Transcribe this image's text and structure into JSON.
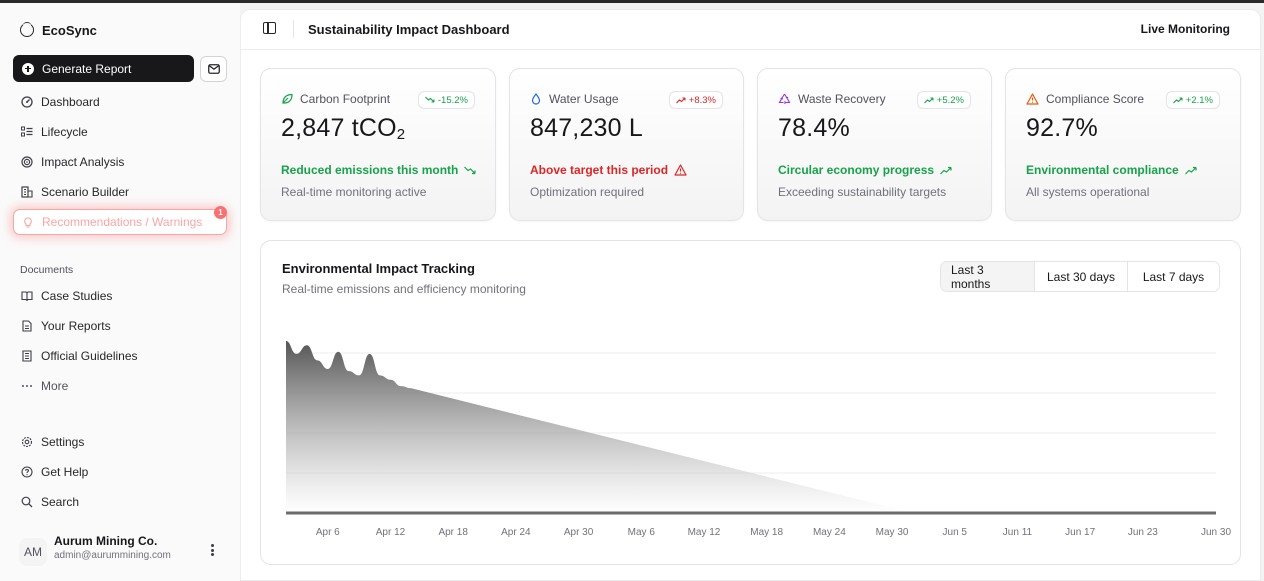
{
  "app": {
    "name": "EcoSync"
  },
  "sidebar": {
    "generate_label": "Generate Report",
    "nav": [
      {
        "label": "Dashboard",
        "icon": "dashboard-icon"
      },
      {
        "label": "Lifecycle",
        "icon": "lifecycle-icon"
      },
      {
        "label": "Impact Analysis",
        "icon": "target-icon"
      },
      {
        "label": "Scenario Builder",
        "icon": "building-icon"
      },
      {
        "label": "Recommendations / Warnings",
        "icon": "lightbulb-icon",
        "badge": "1"
      }
    ],
    "documents_label": "Documents",
    "documents": [
      {
        "label": "Case Studies",
        "icon": "book-icon"
      },
      {
        "label": "Your Reports",
        "icon": "report-icon"
      },
      {
        "label": "Official Guidelines",
        "icon": "document-icon"
      },
      {
        "label": "More",
        "icon": "more-icon"
      }
    ],
    "secondary": [
      {
        "label": "Settings",
        "icon": "gear-icon"
      },
      {
        "label": "Get Help",
        "icon": "help-icon"
      },
      {
        "label": "Search",
        "icon": "search-icon"
      }
    ],
    "user": {
      "initials": "AM",
      "name": "Aurum Mining Co.",
      "email": "admin@aurummining.com"
    }
  },
  "header": {
    "title": "Sustainability Impact Dashboard",
    "live": "Live Monitoring"
  },
  "metrics": [
    {
      "label": "Carbon Footprint",
      "value": "2,847 tCO",
      "value_sub": "2",
      "trend": "-15.2%",
      "trend_dir": "down",
      "status": "Reduced emissions this month",
      "subtitle": "Real-time monitoring active",
      "color": "#16a34a",
      "trend_color": "#16a34a",
      "icon": "leaf-icon"
    },
    {
      "label": "Water Usage",
      "value": "847,230 L",
      "value_sub": "",
      "trend": "+8.3%",
      "trend_dir": "up",
      "status": "Above target this period",
      "subtitle": "Optimization required",
      "color": "#dc2626",
      "trend_color": "#dc2626",
      "icon": "droplet-icon"
    },
    {
      "label": "Waste Recovery",
      "value": "78.4%",
      "value_sub": "",
      "trend": "+5.2%",
      "trend_dir": "up",
      "status": "Circular economy progress",
      "subtitle": "Exceeding sustainability targets",
      "color": "#16a34a",
      "trend_color": "#16a34a",
      "icon": "recycle-icon"
    },
    {
      "label": "Compliance Score",
      "value": "92.7%",
      "value_sub": "",
      "trend": "+2.1%",
      "trend_dir": "up",
      "status": "Environmental compliance",
      "subtitle": "All systems operational",
      "color": "#16a34a",
      "trend_color": "#16a34a",
      "icon": "warning-triangle-icon"
    }
  ],
  "chart_card": {
    "title": "Environmental Impact Tracking",
    "subtitle": "Real-time emissions and efficiency monitoring",
    "ranges": [
      "Last 3 months",
      "Last 30 days",
      "Last 7 days"
    ],
    "active_range": "Last 3 months"
  },
  "chart_data": {
    "type": "area",
    "x_tick_labels": [
      "Apr 6",
      "Apr 12",
      "Apr 18",
      "Apr 24",
      "Apr 30",
      "May 6",
      "May 12",
      "May 18",
      "May 24",
      "May 30",
      "Jun 5",
      "Jun 11",
      "Jun 17",
      "Jun 23",
      "Jun 30"
    ],
    "grid": true,
    "series": [
      {
        "fill": "#555555",
        "points": [
          {
            "x": "Apr 2",
            "y": 160
          },
          {
            "x": "Apr 3",
            "y": 148
          },
          {
            "x": "Apr 4",
            "y": 156
          },
          {
            "x": "Apr 5",
            "y": 142
          },
          {
            "x": "Apr 6",
            "y": 134
          },
          {
            "x": "Apr 7",
            "y": 150
          },
          {
            "x": "Apr 8",
            "y": 132
          },
          {
            "x": "Apr 9",
            "y": 128
          },
          {
            "x": "Apr 10",
            "y": 148
          },
          {
            "x": "Apr 11",
            "y": 128
          },
          {
            "x": "Apr 12",
            "y": 124
          },
          {
            "x": "Apr 13",
            "y": 118
          },
          {
            "x": "Apr 14",
            "y": 116
          },
          {
            "x": "Jun 1",
            "y": 0
          },
          {
            "x": "Jun 30",
            "y": 0
          }
        ]
      }
    ]
  }
}
